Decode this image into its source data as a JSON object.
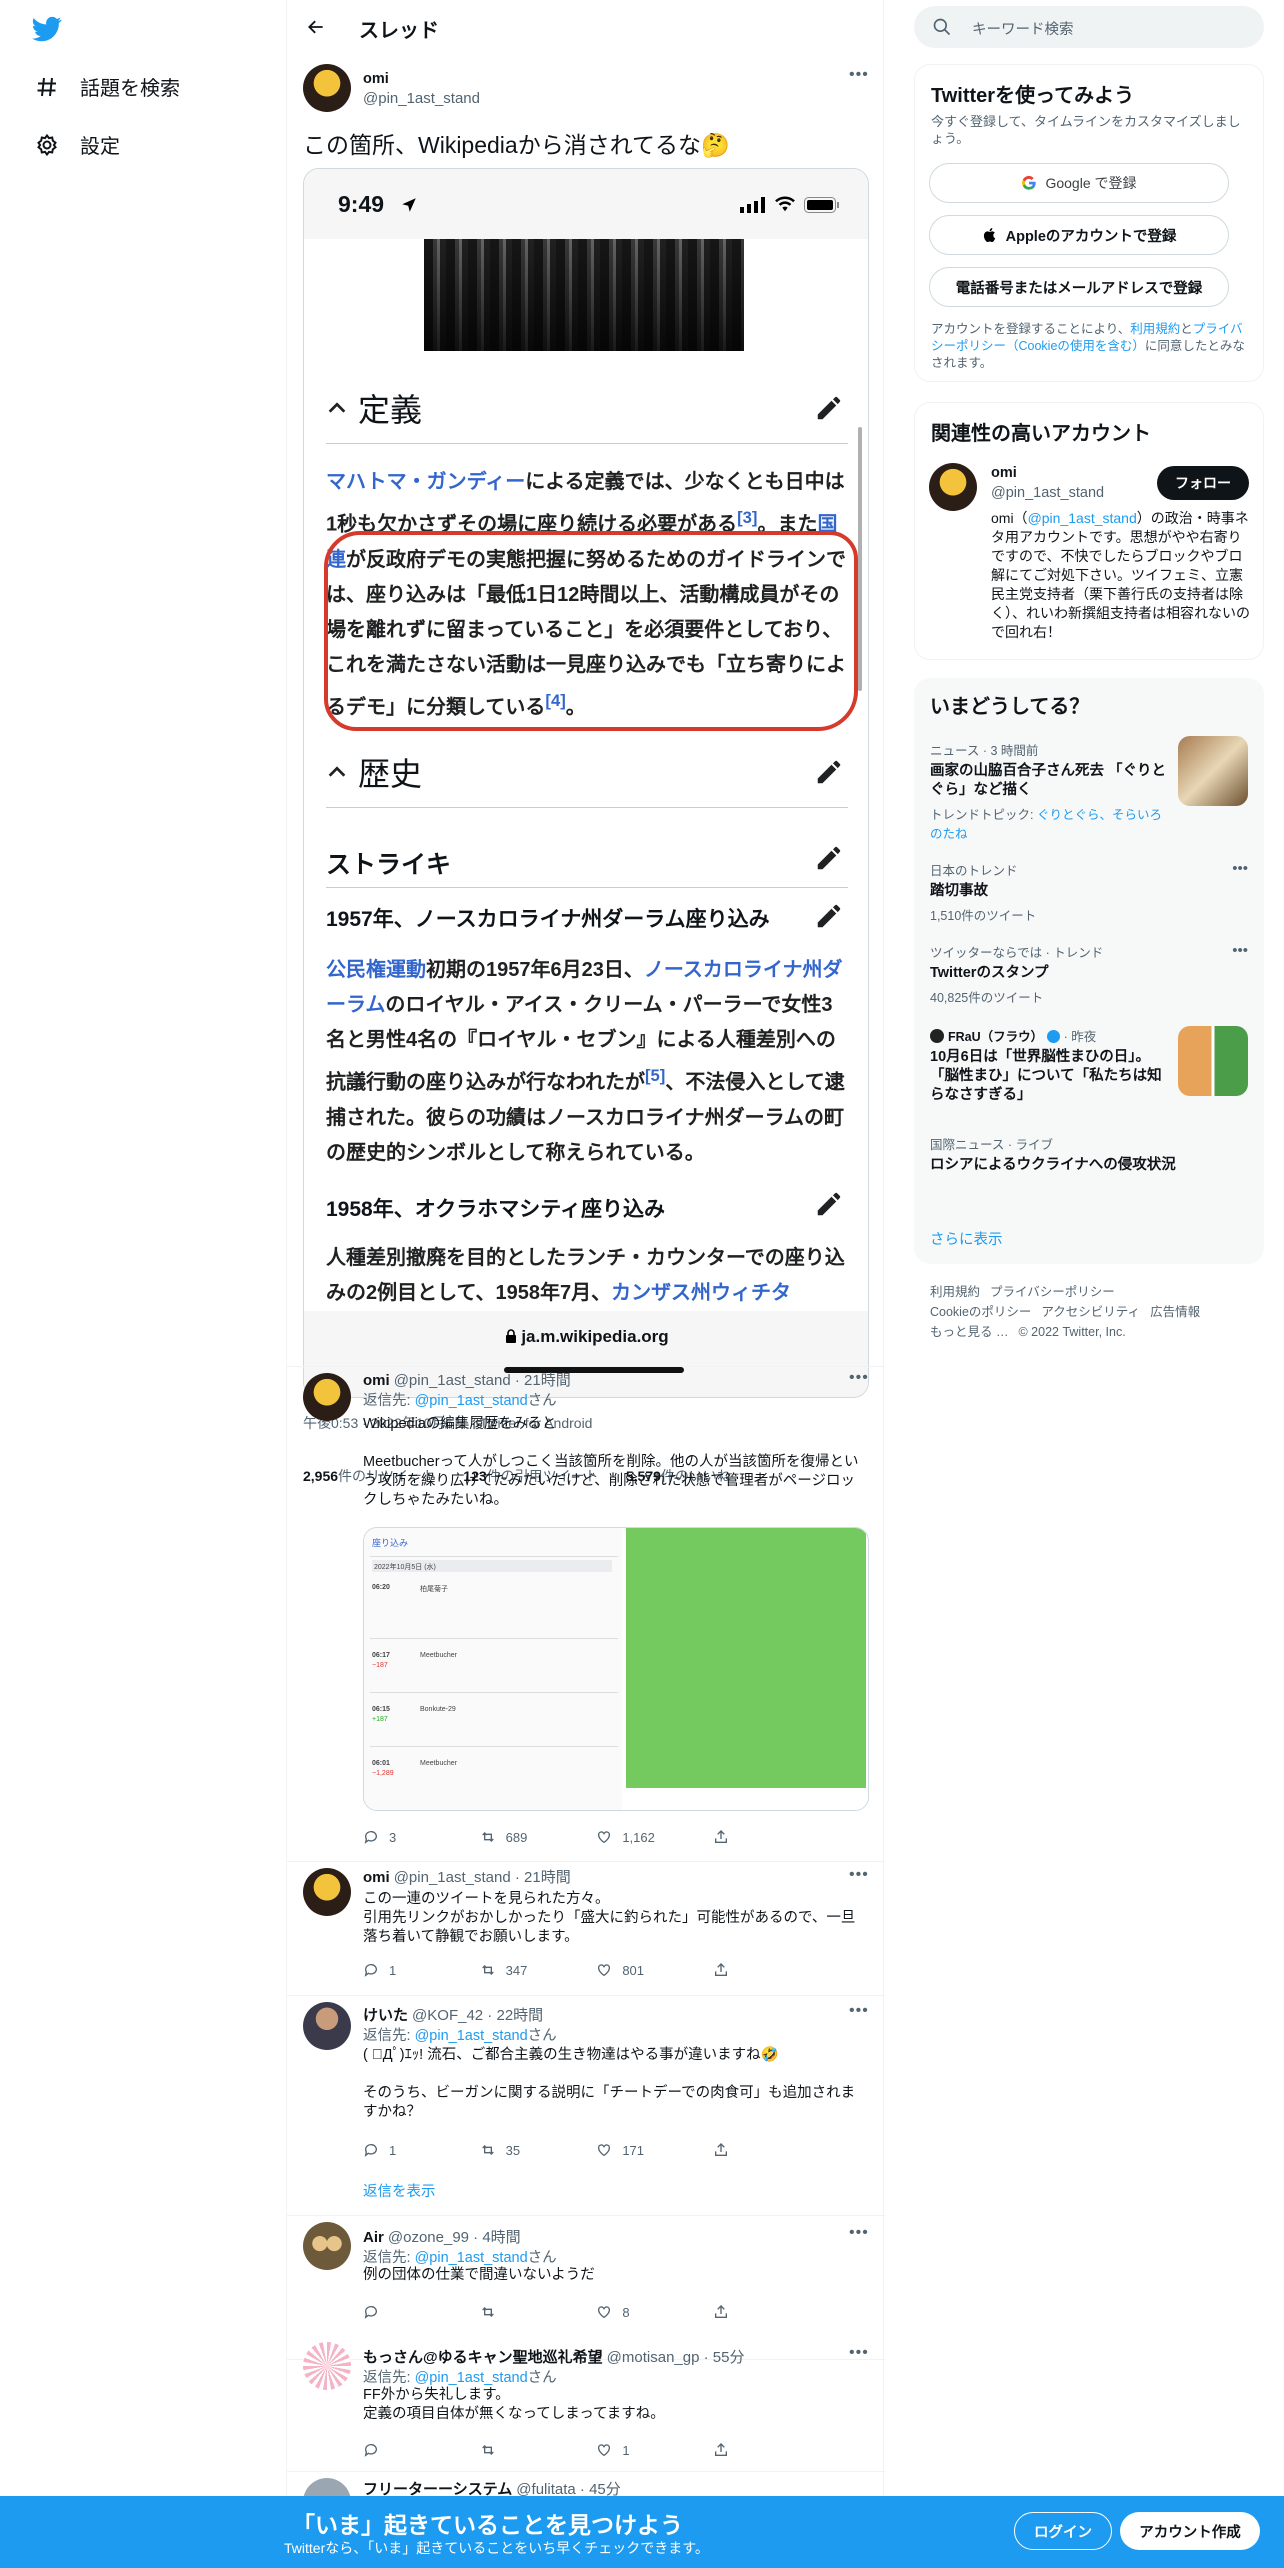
{
  "nav": {
    "explore_label": "話題を検索",
    "settings_label": "設定"
  },
  "header": {
    "title": "スレッド"
  },
  "main_tweet": {
    "name": "omi",
    "handle": "@pin_1ast_stand",
    "text": "この箇所、Wikipediaから消されてるな🤔",
    "timestamp": "午後0:53 · 2022年10月6日 · Twitter for Android",
    "retweets_count": "2,956",
    "retweets_label": "件のリツイート",
    "quotes_count": "123",
    "quotes_label": "件の引用ツイート",
    "likes_count": "5,579",
    "likes_label": "件のいいね"
  },
  "screenshot": {
    "status_time": "9:49",
    "section_definition": "定義",
    "para1_link1": "マハトマ・ガンディー",
    "para1_text1": "による定義では、少なくとも日中は1秒も欠かさずその場に座り続ける必要がある",
    "para1_ref": "[3]",
    "para1_text2": "。また",
    "para1_link2": "国連",
    "para1_text3": "が反政府デモの実態把握に努めるためのガイドラインでは、座り込みは「最低1日12時間以上、活動構成員がその場を離れずに留まっていること」を必須要件としており、これを満たさない活動は一見座り込みでも「立ち寄りによるデモ」に分類している",
    "para1_ref2": "[4]",
    "para1_end": "。",
    "section_history": "歴史",
    "h3_strike": "ストライキ",
    "h4_1957": "1957年、ノースカロライナ州ダーラム座り込み",
    "para2_link1": "公民権運動",
    "para2_text1": "初期の1957年6月23日、",
    "para2_link2": "ノースカロライナ州ダーラム",
    "para2_text2": "のロイヤル・アイス・クリーム・パーラーで女性3名と男性4名の『ロイヤル・セブン』による人種差別への抗議行動の座り込みが行なわれたが",
    "para2_ref": "[5]",
    "para2_text3": "、不法侵入として逮捕された。彼らの功績はノースカロライナ州ダーラムの町の歴史的シンボルとして称えられている。",
    "h4_1958": "1958年、オクラホマシティ座り込み",
    "para3_text1": "人種差別撤廃を目的としたランチ・カウンターでの座り込みの2例目として、1958年7月、",
    "para3_link": "カンザス州ウィチタ",
    "url": "ja.m.wikipedia.org"
  },
  "replies": [
    {
      "name": "omi",
      "handle": "@pin_1ast_stand",
      "time": "21時間",
      "reply_prefix": "返信先: ",
      "reply_to": "@pin_1ast_stand",
      "reply_suffix": "さん",
      "text_line1": "Wikipediaの編集履歴をみると",
      "text_line2": "Meetbucherって人がしつこく当該箇所を削除。他の人が当該箇所を復帰という攻防を繰り広げてたみたいだけど、削除された状態で管理者がページロックしちゃたみたいね。",
      "replies": "3",
      "retweets": "689",
      "likes": "1,162"
    },
    {
      "name": "omi",
      "handle": "@pin_1ast_stand",
      "time": "21時間",
      "text_line1": "この一連のツイートを見られた方々。",
      "text_line2": "引用先リンクがおかしかったり「盛大に釣られた」可能性があるので、一旦落ち着いて静観でお願いします。",
      "replies": "1",
      "retweets": "347",
      "likes": "801"
    },
    {
      "name": "けいた",
      "handle": "@KOF_42",
      "time": "22時間",
      "reply_prefix": "返信先: ",
      "reply_to": "@pin_1ast_stand",
      "reply_suffix": "さん",
      "text_line1": "( ﾟДﾟ)ｴｯ!  流石、ご都合主義の生き物達はやる事が違いますね🤣",
      "text_line2": "そのうち、ビーガンに関する説明に「チートデーでの肉食可」も追加されますかね？",
      "replies": "1",
      "retweets": "35",
      "likes": "171",
      "show_replies": "返信を表示"
    },
    {
      "name": "Air",
      "handle": "@ozone_99",
      "time": "4時間",
      "reply_prefix": "返信先: ",
      "reply_to": "@pin_1ast_stand",
      "reply_suffix": "さん",
      "text_line1": "例の団体の仕業で間違いないようだ",
      "likes": "8"
    },
    {
      "name": "もっさん@ゆるキャン聖地巡礼希望",
      "handle": "@motisan_gp",
      "time": "55分",
      "reply_prefix": "返信先: ",
      "reply_to": "@pin_1ast_stand",
      "reply_suffix": "さん",
      "text_line1": "FF外から失礼します。",
      "text_line2": "定義の項目自体が無くなってしまってますね。",
      "likes": "1"
    },
    {
      "name": "フリーターーシステム",
      "handle": "@fulitata",
      "time": "45分"
    }
  ],
  "sidebar": {
    "search_placeholder": "キーワード検索",
    "signup_card": {
      "title": "Twitterを使ってみよう",
      "subtitle": "今すぐ登録して、タイムラインをカスタマイズしましょう。",
      "google_button": "Google で登録",
      "apple_button": "Appleのアカウントで登録",
      "phone_button": "電話番号またはメールアドレスで登録",
      "legal_1": "アカウントを登録することにより、",
      "legal_link1": "利用規約",
      "legal_2": "と",
      "legal_link2": "プライバシーポリシー（Cookieの使用を含む）",
      "legal_3": "に同意したとみなされます。"
    },
    "relevant_card": {
      "title": "関連性の高いアカウント",
      "name": "omi",
      "handle": "@pin_1ast_stand",
      "follow": "フォロー",
      "bio_1": "omi（",
      "bio_link": "@pin_1ast_stand",
      "bio_2": "）の政治・時事ネタ用アカウントです。思想がやや右寄りですので、不快でしたらブロックやブロ解にてご対処下さい。ツイフェミ、立憲民主党支持者（栗下善行氏の支持者は除く）、れいわ新撰組支持者は相容れないので回れ右！"
    },
    "trends_card": {
      "title": "いまどうしてる？",
      "t1_meta": "ニュース · 3 時間前",
      "t1_title": "画家の山脇百合子さん死去 「ぐりとぐら」など描く",
      "t1_sub_prefix": "トレンドトピック: ",
      "t1_sub_links": "ぐりとぐら、そらいろのたね",
      "t2_meta": "日本のトレンド",
      "t2_title": "踏切事故",
      "t2_sub": "1,510件のツイート",
      "t3_meta": "ツイッターならでは · トレンド",
      "t3_title": "Twitterのスタンプ",
      "t3_sub": "40,825件のツイート",
      "t4_meta_name": "FRaU（フラウ）",
      "t4_meta_time": " · 昨夜",
      "t4_title": "10月6日は「世界脳性まひの日」。「脳性まひ」について「私たちは知らなさすぎる」",
      "t5_meta": "国際ニュース · ライブ",
      "t5_title": "ロシアによるウクライナへの侵攻状況",
      "show_more": "さらに表示"
    },
    "footer": {
      "terms": "利用規約",
      "privacy": "プライバシーポリシー",
      "cookie": "Cookieのポリシー",
      "accessibility": "アクセシビリティ",
      "ads": "広告情報",
      "more": "もっと見る …",
      "copyright": "© 2022 Twitter, Inc."
    }
  },
  "banner": {
    "headline": "「いま」起きていることを見つけよう",
    "subline": "Twitterなら、「いま」起きていることをいち早くチェックできます。",
    "login": "ログイン",
    "signup": "アカウント作成"
  },
  "colors": {
    "accent": "#1d9bf0",
    "text": "#0f1419",
    "muted": "#536471",
    "wiki_link": "#3366cc",
    "annotation_red": "#d63a2b"
  }
}
